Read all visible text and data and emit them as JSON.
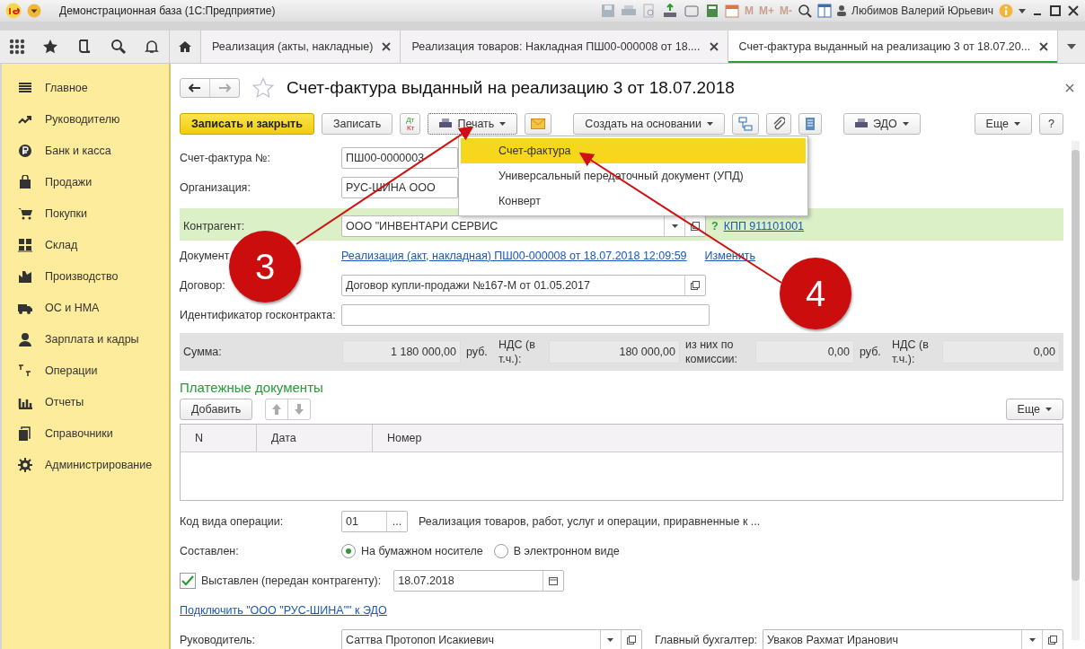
{
  "window": {
    "title": "Демонстрационная база  (1С:Предприятие)",
    "memory_buttons": [
      "M",
      "M+",
      "M-"
    ],
    "user": "Любимов Валерий Юрьевич"
  },
  "tabs": [
    {
      "label": "Реализация (акты, накладные)",
      "selected": false
    },
    {
      "label": "Реализация товаров: Накладная ПШ00-000008 от 18....",
      "selected": false
    },
    {
      "label": "Счет-фактура выданный на реализацию 3 от 18.07.20...",
      "selected": true
    }
  ],
  "sidebar": {
    "items": [
      {
        "label": "Главное"
      },
      {
        "label": "Руководителю"
      },
      {
        "label": "Банк и касса"
      },
      {
        "label": "Продажи"
      },
      {
        "label": "Покупки"
      },
      {
        "label": "Склад"
      },
      {
        "label": "Производство"
      },
      {
        "label": "ОС и НМА"
      },
      {
        "label": "Зарплата и кадры"
      },
      {
        "label": "Операции"
      },
      {
        "label": "Отчеты"
      },
      {
        "label": "Справочники"
      },
      {
        "label": "Администрирование"
      }
    ]
  },
  "form": {
    "title": "Счет-фактура выданный на реализацию 3 от 18.07.2018",
    "toolbar": {
      "save_close": "Записать и закрыть",
      "save": "Записать",
      "debit": "Дт",
      "credit": "Кт",
      "print": "Печать",
      "create_based": "Создать на основании",
      "edo": "ЭДО",
      "more": "Еще",
      "help": "?"
    },
    "print_menu": [
      {
        "label": "Счет-фактура",
        "selected": true
      },
      {
        "label": "Универсальный передаточный документ (УПД)",
        "selected": false
      },
      {
        "label": "Конверт",
        "selected": false
      }
    ],
    "number": {
      "label": "Счет-фактура №:",
      "value": "ПШ00-0000003"
    },
    "organization": {
      "label": "Организация:",
      "value": "РУС-ШИНА ООО"
    },
    "counterparty": {
      "label": "Контрагент:",
      "value": "ООО \"ИНВЕНТАРИ СЕРВИС",
      "help": "?",
      "kpp": "КПП 911101001"
    },
    "document": {
      "label": "Документ",
      "link": "Реализация (акт, накладная) ПШ00-000008 от 18.07.2018 12:09:59",
      "change": "Изменить"
    },
    "contract": {
      "label": "Договор:",
      "value": "Договор купли-продажи №167-М от 01.05.2017"
    },
    "gov_contract": {
      "label": "Идентификатор госконтракта:"
    },
    "totals": {
      "sum_label": "Сумма:",
      "sum": "1 180 000,00",
      "currency": "руб.",
      "vat_label": "НДС (в т.ч.):",
      "vat": "180 000,00",
      "commission_label": "из них по комиссии:",
      "commission": "0,00",
      "commission_currency": "руб.",
      "commission_vat_label": "НДС (в т.ч.):",
      "commission_vat": "0,00"
    },
    "payments": {
      "title": "Платежные документы",
      "add": "Добавить",
      "more": "Еще",
      "columns": [
        "N",
        "Дата",
        "Номер"
      ]
    },
    "operation_code": {
      "label": "Код вида операции:",
      "value": "01",
      "select": "...",
      "description": "Реализация товаров, работ, услуг и операции, приравненные к ..."
    },
    "composed": {
      "label": "Составлен:",
      "options": [
        {
          "label": "На бумажном носителе",
          "selected": true
        },
        {
          "label": "В электронном виде",
          "selected": false
        }
      ]
    },
    "issued": {
      "label": "Выставлен (передан контрагенту):",
      "checked": true,
      "date": "18.07.2018"
    },
    "edo_link": "Подключить \"ООО \"РУС-ШИНА\"\" к ЭДО",
    "signers": [
      {
        "label": "Руководитель:",
        "value": "Саттва Протопоп Исакиевич"
      },
      {
        "label": "Главный бухгалтер:",
        "value": "Уваков Рахмат Иранович"
      }
    ]
  },
  "annotations": [
    {
      "label": "3"
    },
    {
      "label": "4"
    }
  ]
}
